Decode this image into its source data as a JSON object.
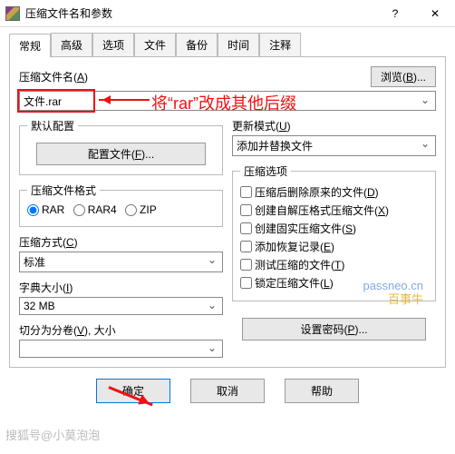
{
  "window": {
    "title": "压缩文件名和参数"
  },
  "tabs": [
    "常规",
    "高级",
    "选项",
    "文件",
    "备份",
    "时间",
    "注释"
  ],
  "labels": {
    "filename": "压缩文件名(",
    "filename_u": "A",
    "filename_end": ")",
    "browse": "浏览(",
    "browse_u": "B",
    "browse_end": ")...",
    "default_cfg": "默认配置",
    "cfg_btn": "配置文件(",
    "cfg_u": "F",
    "cfg_end": ")...",
    "update": "更新模式(",
    "update_u": "U",
    "update_end": ")",
    "update_val": "添加并替换文件",
    "format": "压缩文件格式",
    "method": "压缩方式(",
    "method_u": "C",
    "method_end": ")",
    "method_val": "标准",
    "dict": "字典大小(",
    "dict_u": "I",
    "dict_end": ")",
    "dict_val": "32 MB",
    "split": "切分为分卷(",
    "split_u": "V",
    "split_end": "), 大小",
    "opts": "压缩选项",
    "pwd": "设置密码(",
    "pwd_u": "P",
    "pwd_end": ")..."
  },
  "file_value": "文件.rar",
  "annotation": "将“rar”改成其他后缀",
  "formats": {
    "rar": "RAR",
    "rar4": "RAR4",
    "zip": "ZIP"
  },
  "options": [
    {
      "t": "压缩后删除原来的文件(",
      "u": "D",
      "e": ")"
    },
    {
      "t": "创建自解压格式压缩文件(",
      "u": "X",
      "e": ")"
    },
    {
      "t": "创建固实压缩文件(",
      "u": "S",
      "e": ")"
    },
    {
      "t": "添加恢复记录(",
      "u": "E",
      "e": ")"
    },
    {
      "t": "测试压缩的文件(",
      "u": "T",
      "e": ")"
    },
    {
      "t": "锁定压缩文件(",
      "u": "L",
      "e": ")"
    }
  ],
  "footer": {
    "ok": "确定",
    "cancel": "取消",
    "help": "帮助"
  },
  "wm": {
    "a": "passneo.cn",
    "b": "百事牛",
    "c": "搜狐号@小莫泡泡"
  }
}
